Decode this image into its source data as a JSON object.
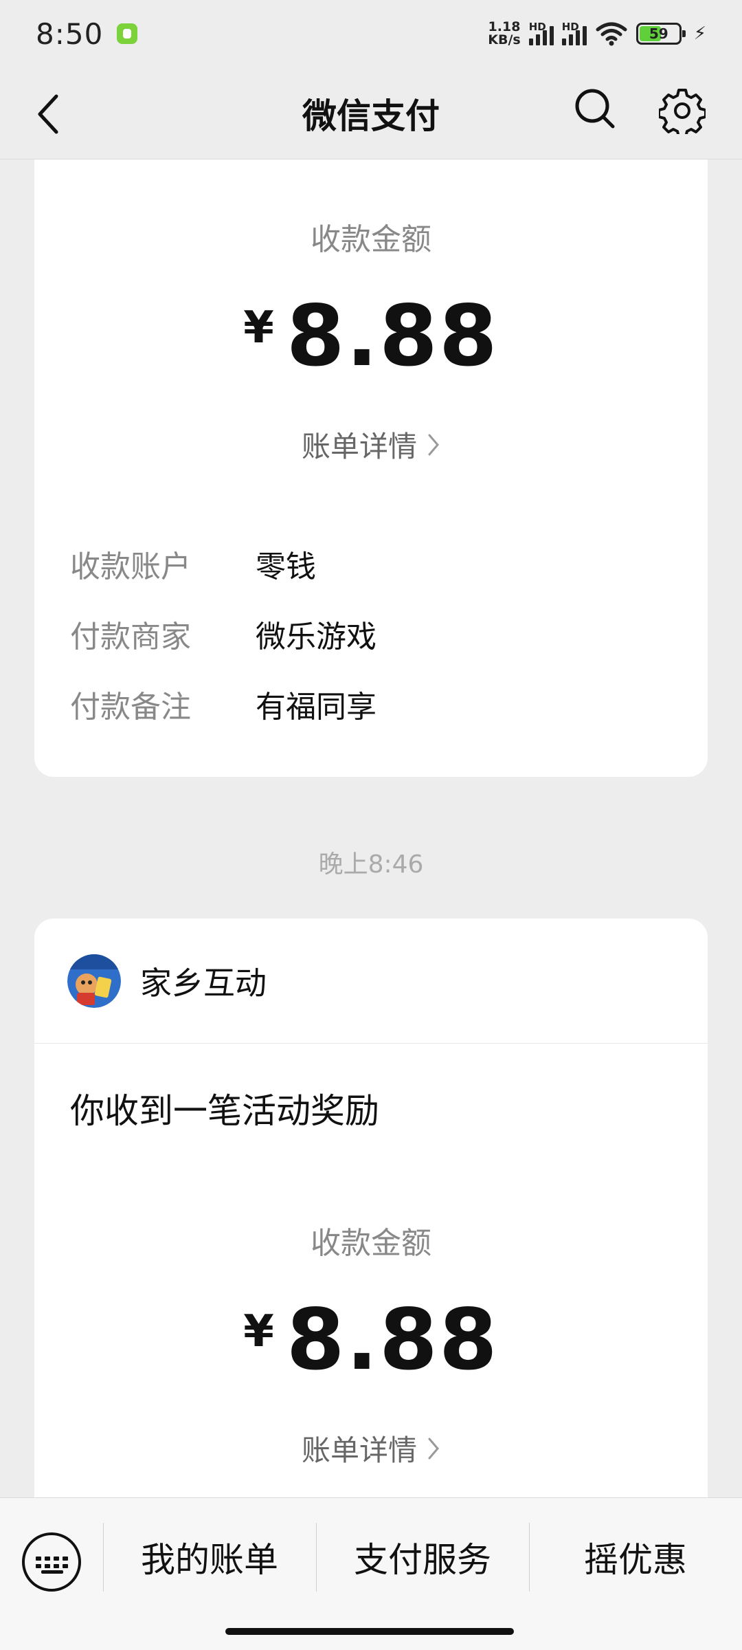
{
  "status_bar": {
    "time": "8:50",
    "net_speed_value": "1.18",
    "net_speed_unit": "KB/s",
    "hd_label": "HD",
    "battery_level": 59,
    "battery_label": "59"
  },
  "nav": {
    "title": "微信支付"
  },
  "first_card": {
    "amount_label": "收款金额",
    "currency": "¥",
    "amount": "8.88",
    "detail_link": "账单详情",
    "info_rows": [
      {
        "label": "收款账户",
        "value": "零钱"
      },
      {
        "label": "付款商家",
        "value": "微乐游戏"
      },
      {
        "label": "付款备注",
        "value": "有福同享"
      }
    ]
  },
  "timestamp": "晚上8:46",
  "second_card": {
    "merchant_name": "家乡互动",
    "message": "你收到一笔活动奖励",
    "amount_label": "收款金额",
    "currency": "¥",
    "amount": "8.88",
    "detail_link": "账单详情"
  },
  "bottom_menu": {
    "items": [
      "我的账单",
      "支付服务",
      "摇优惠"
    ]
  },
  "colors": {
    "background": "#ededed",
    "card": "#ffffff",
    "secondary_text": "#888888",
    "battery_green": "#5fcf3a"
  }
}
